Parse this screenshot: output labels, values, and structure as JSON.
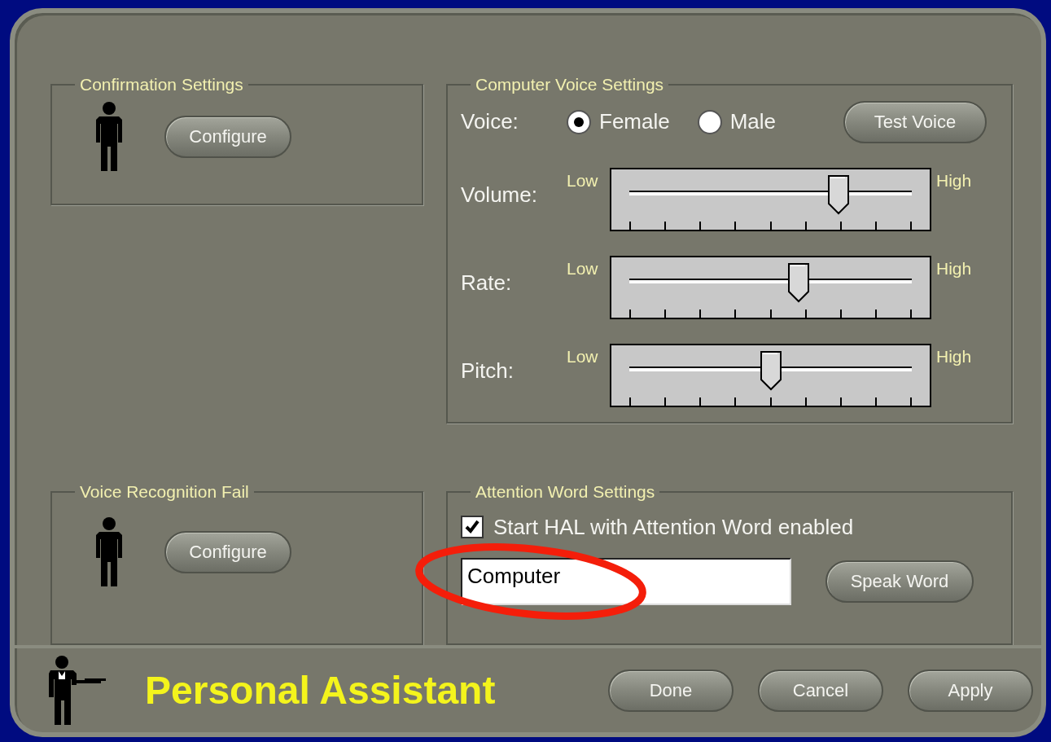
{
  "confirmation": {
    "title": "Confirmation Settings",
    "button": "Configure"
  },
  "voice_settings": {
    "title": "Computer Voice Settings",
    "voice_label": "Voice:",
    "options": [
      {
        "label": "Female",
        "selected": true
      },
      {
        "label": "Male",
        "selected": false
      }
    ],
    "test_button": "Test Voice",
    "sliders": [
      {
        "label": "Volume:",
        "low": "Low",
        "high": "High",
        "level": 0.74
      },
      {
        "label": "Rate:",
        "low": "Low",
        "high": "High",
        "level": 0.6
      },
      {
        "label": "Pitch:",
        "low": "Low",
        "high": "High",
        "level": 0.5
      }
    ]
  },
  "recognition_fail": {
    "title": "Voice Recognition Fail",
    "button": "Configure"
  },
  "attention_word": {
    "title": "Attention Word Settings",
    "checkbox": {
      "label": "Start HAL with Attention Word enabled",
      "checked": true
    },
    "field": {
      "value": "Computer",
      "circled": true
    },
    "button": "Speak Word"
  },
  "footer": {
    "title": "Personal Assistant",
    "buttons": [
      "Done",
      "Cancel",
      "Apply"
    ]
  }
}
